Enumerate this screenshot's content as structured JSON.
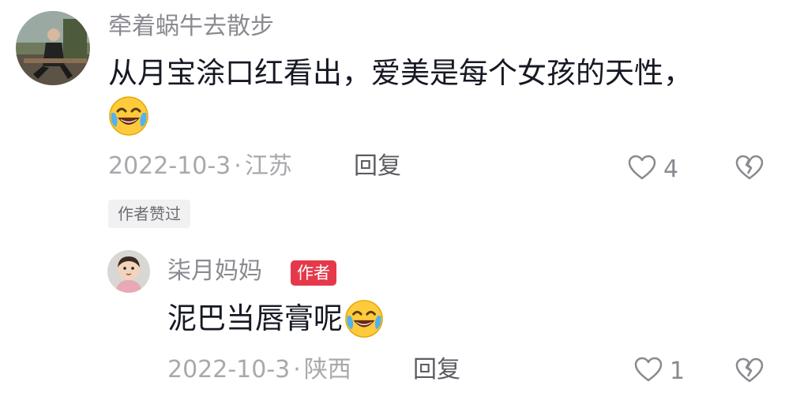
{
  "comment": {
    "username": "牵着蜗牛去散步",
    "text": "从月宝涂口红看出，爱美是每个女孩的天性，",
    "emoji": "laughing-crying-emoji",
    "date": "2022-10-3",
    "separator": "·",
    "location": "江苏",
    "reply_label": "回复",
    "like_count": "4",
    "liked_by_author_label": "作者赞过"
  },
  "reply": {
    "username": "柒月妈妈",
    "author_badge": "作者",
    "text": "泥巴当唇膏呢",
    "emoji": "laughing-crying-emoji",
    "date": "2022-10-3",
    "separator": "·",
    "location": "陕西",
    "reply_label": "回复",
    "like_count": "1"
  },
  "colors": {
    "author_badge": "#e5394b",
    "text_primary": "#161823",
    "text_secondary": "#8a8b91"
  }
}
